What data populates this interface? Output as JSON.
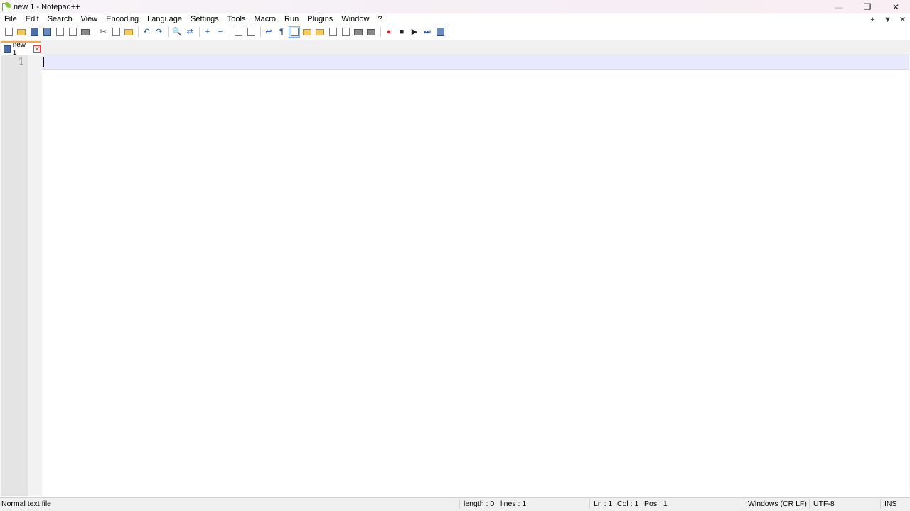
{
  "window": {
    "title": "new 1 - Notepad++",
    "controls": {
      "minimize": "—",
      "restore": "❐",
      "close": "✕"
    }
  },
  "menu": {
    "items": [
      "File",
      "Edit",
      "Search",
      "View",
      "Encoding",
      "Language",
      "Settings",
      "Tools",
      "Macro",
      "Run",
      "Plugins",
      "Window",
      "?"
    ],
    "right": {
      "add": "+",
      "dropdown": "▼",
      "close": "✕"
    }
  },
  "toolbar": {
    "buttons": [
      "new-file",
      "open-file",
      "save",
      "save-all",
      "close",
      "close-all",
      "print",
      "cut",
      "copy",
      "paste",
      "undo",
      "redo",
      "find",
      "replace",
      "zoom-in",
      "zoom-out",
      "sync-vertical",
      "sync-horizontal",
      "word-wrap",
      "show-all-chars",
      "indent-guide",
      "udl",
      "doc-map",
      "function-list",
      "folder-workspace",
      "monitoring",
      "record-macro",
      "stop-recording",
      "playback",
      "run-multiple",
      "save-macro"
    ],
    "glyphs": {
      "cut": "✂",
      "undo": "↶",
      "redo": "↷",
      "find": "🔍",
      "replace": "⇄",
      "zoom-in": "+",
      "zoom-out": "−",
      "word-wrap": "↩",
      "show-all-chars": "¶",
      "record": "●",
      "stop": "■",
      "play": "▶",
      "run-multiple": "⏭"
    }
  },
  "tabs": [
    {
      "label": "new 1",
      "close": "✕",
      "active": true
    }
  ],
  "editor": {
    "line_numbers": [
      "1"
    ],
    "content": ""
  },
  "status": {
    "file_type": "Normal text file",
    "length": "length : 0",
    "lines": "lines : 1",
    "ln": "Ln : 1",
    "col": "Col : 1",
    "pos": "Pos : 1",
    "eol": "Windows (CR LF)",
    "encoding": "UTF-8",
    "mode": "INS"
  },
  "colors": {
    "current_line": "#e8e8ff",
    "gutter": "#e4e4e4",
    "tab_accent": "#f7a84b",
    "statusbar": "#f0f0f0"
  }
}
